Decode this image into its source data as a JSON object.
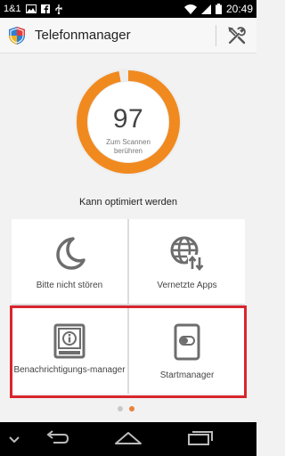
{
  "status_bar": {
    "carrier": "1&1",
    "time": "20:49",
    "icons": [
      "image-icon",
      "facebook-icon",
      "usb-debug-icon",
      "wifi-icon",
      "signal-icon",
      "battery-icon"
    ]
  },
  "app_bar": {
    "title": "Telefonmanager",
    "logo_icon": "shield-logo-icon",
    "settings_icon": "tools-icon"
  },
  "gauge": {
    "score": "97",
    "caption": "Zum Scannen berühren",
    "progress": 0.97,
    "accent_color": "#f08a1f"
  },
  "status_message": "Kann optimiert werden",
  "tiles": [
    {
      "label": "Bitte nicht stören",
      "icon": "moon-icon"
    },
    {
      "label": "Vernetzte Apps",
      "icon": "globe-network-icon"
    },
    {
      "label": "Benachrichtigungs-manager",
      "icon": "notification-info-icon"
    },
    {
      "label": "Startmanager",
      "icon": "startup-toggle-icon"
    }
  ],
  "pager": {
    "pages": 2,
    "active_page": 2
  },
  "nav_bar": {
    "buttons": [
      "collapse-icon",
      "back-icon",
      "home-icon",
      "recent-apps-icon"
    ]
  },
  "colors": {
    "highlight": "#d9252e",
    "accent": "#f08a1f",
    "icon_gray": "#6d6d6d"
  }
}
